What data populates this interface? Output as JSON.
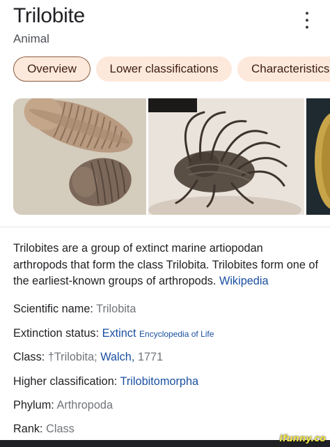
{
  "header": {
    "title": "Trilobite",
    "subtitle": "Animal"
  },
  "tabs": [
    {
      "label": "Overview",
      "active": true
    },
    {
      "label": "Lower classifications",
      "active": false
    },
    {
      "label": "Characteristics",
      "active": false
    }
  ],
  "description": {
    "text": "Trilobites are a group of extinct marine artiopodan arthropods that form the class Trilobita. Trilobites form one of the earliest-known groups of arthropods.",
    "source_link": "Wikipedia"
  },
  "facts": {
    "scientific_name": {
      "label": "Scientific name:",
      "value": "Trilobita"
    },
    "extinction_status": {
      "label": "Extinction status:",
      "value": "Extinct",
      "source": "Encyclopedia of Life"
    },
    "class": {
      "label": "Class:",
      "value": "†Trilobita;",
      "author": "Walch,",
      "year": "1771"
    },
    "higher_classification": {
      "label": "Higher classification:",
      "value": "Trilobitomorpha"
    },
    "phylum": {
      "label": "Phylum:",
      "value": "Arthropoda"
    },
    "rank": {
      "label": "Rank:",
      "value": "Class"
    }
  },
  "watermark": "ifunny.co",
  "colors": {
    "chip_bg": "#fde9dc",
    "chip_active_border": "#8a5a3f",
    "link": "#1a0dab"
  }
}
